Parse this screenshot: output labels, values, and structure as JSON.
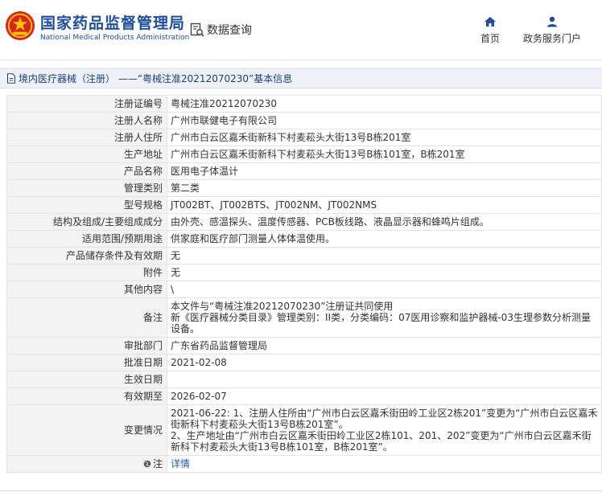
{
  "header": {
    "site_title": "国家药品监督管理局",
    "site_subtitle": "National Medical Products Administration",
    "data_query": "数据查询",
    "nav_home": "首页",
    "nav_portal": "政务服务门户"
  },
  "breadcrumb": {
    "text": "境内医疗器械（注册） ——“粤械注准20212070230”基本信息"
  },
  "rows": [
    {
      "label": "注册证编号",
      "value": "粤械注准20212070230"
    },
    {
      "label": "注册人名称",
      "value": "广州市联健电子有限公司"
    },
    {
      "label": "注册人住所",
      "value": "广州市白云区嘉禾街新科下村麦菘头大街13号B栋201室"
    },
    {
      "label": "生产地址",
      "value": "广州市白云区嘉禾街新科下村麦菘头大街13号B栋101室，B栋201室"
    },
    {
      "label": "产品名称",
      "value": "医用电子体温计"
    },
    {
      "label": "管理类别",
      "value": "第二类"
    },
    {
      "label": "型号规格",
      "value": "JT002BT、JT002BTS、JT002NM、JT002NMS"
    },
    {
      "label": "结构及组成/主要组成成分",
      "value": "由外壳、感温探头、温度传感器、PCB板线路、液晶显示器和蜂鸣片组成。"
    },
    {
      "label": "适用范围/预期用途",
      "value": "供家庭和医疗部门测量人体体温使用。"
    },
    {
      "label": "产品储存条件及有效期",
      "value": "无"
    },
    {
      "label": "附件",
      "value": "无"
    },
    {
      "label": "其他内容",
      "value": "\\"
    },
    {
      "label": "备注",
      "value_lines": [
        "本文件与“粤械注准20212070230”注册证共同使用",
        "新《医疗器械分类目录》管理类别：II类，分类编码：07医用诊察和监护器械-03生理参数分析测量设备。"
      ]
    },
    {
      "label": "审批部门",
      "value": "广东省药品监督管理局"
    },
    {
      "label": "批准日期",
      "value": "2021-02-08"
    },
    {
      "label": "生效日期",
      "value": ""
    },
    {
      "label": "有效期至",
      "value": "2026-02-07"
    },
    {
      "label": "变更情况",
      "value_lines": [
        "2021-06-22: 1、注册人住所由“广州市白云区嘉禾街田岭工业区2栋201”变更为“广州市白云区嘉禾街新科下村麦菘头大街13号B栋201室”。",
        "2、生产地址由“广州市白云区嘉禾街田岭工业区2栋101、201、202”变更为“广州市白云区嘉禾街新科下村麦菘头大街13号B栋101室，B栋201室”。"
      ]
    },
    {
      "label": "注",
      "value": "详情"
    }
  ],
  "colors": {
    "brand_blue": "#1f4e9c",
    "link_blue": "#1f5aa6",
    "label_bg": "#f3f3f3",
    "logo_red": "#d7261e",
    "logo_gold": "#f5c400"
  },
  "icons": {
    "logo": "national-emblem-logo",
    "data_query": "document-search-icon",
    "home": "home-icon",
    "portal": "user-icon",
    "breadcrumb": "document-icon",
    "note": "globe-icon"
  }
}
